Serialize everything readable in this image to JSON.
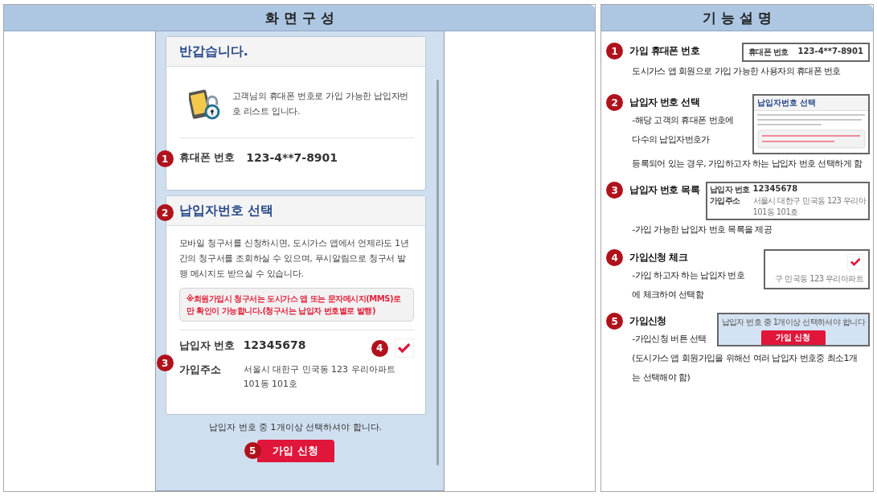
{
  "left_header": {
    "title": "화 면 구 성"
  },
  "right_header": {
    "title": "기 능 설 명"
  },
  "phone": {
    "welcome": {
      "title": "반갑습니다.",
      "message": "고객님의 휴대폰 번호로 가입 가능한 납입자번호 리스트 입니다.",
      "badge": "1",
      "phone_label": "휴대폰 번호",
      "phone_value": "123-4**7-8901"
    },
    "select": {
      "badge": "2",
      "title": "납입자번호 선택",
      "description": "모바일 청구서를 신청하시면, 도시가스 앱에서 언제라도 1년간의 청구서를 조회하실 수 있으며, 푸시알림으로 청구서 발행 메시지도 받으실 수 있습니다.",
      "notice": "※회원가입시 청구서는 도시가스 앱 또는 문자메시지(MMS)로만 확인이 가능합니다.(청구서는 납입자 번호별로 발행)"
    },
    "payers": [
      {
        "badge": "3",
        "number_label": "납입자 번호",
        "number": "12345678",
        "address_label": "가입주소",
        "address": "서울시 대한구 민국동 123 우리아파트 101동 101호",
        "check_badge": "4",
        "checked": true
      }
    ],
    "footer_note": "납입자 번호 중 1개이상 선택하셔야 합니다.",
    "submit": {
      "badge": "5",
      "label": "가입 신청"
    }
  },
  "features": [
    {
      "badge": "1",
      "title": "가입 휴대폰 번호",
      "lines": [
        "도시가스 앱 회원으로 가입 가능한 사용자의 휴대폰 번호"
      ],
      "thumb": {
        "kind": "phone",
        "label": "휴대폰 번호",
        "value": "123-4**7-8901"
      }
    },
    {
      "badge": "2",
      "title": "납입자 번호 선택",
      "lines": [
        "-해당 고객의 휴대폰 번호에",
        "다수의 납입자번호가",
        "등록되어 있는 경우, 가입하고자 하는 납입자 번호 선택하게 함"
      ],
      "thumb": {
        "kind": "section",
        "title": "납입자번호 선택"
      }
    },
    {
      "badge": "3",
      "title": "납입자 번호 목록",
      "lines": [
        "-가입 가능한 납입자 번호 목록을 제공"
      ],
      "thumb": {
        "kind": "payer",
        "number_label": "납입자 번호",
        "number": "12345678",
        "address_label": "가입주소",
        "address": "서울시 대한구 민국동 123 우리아",
        "address2": "101동 101호"
      }
    },
    {
      "badge": "4",
      "title": "가입신청 체크",
      "lines": [
        "-가입 하고자 하는 납입자 번호",
        "에  체크하여 선택함"
      ],
      "thumb": {
        "kind": "check",
        "checked": true,
        "address": "구 민국동 123 우리아파트"
      }
    },
    {
      "badge": "5",
      "title": "가입신청",
      "lines": [
        "-가입신청 버튼 선택",
        "(도시가스 앱 회원가입을 위해선 여러 납입자 번호중 최소1개",
        "는 선택해야 함)"
      ],
      "thumb": {
        "kind": "submit",
        "note": "납입자 번호 중 1개이상 선택하셔야 합니다",
        "label": "가입 신청"
      }
    }
  ]
}
